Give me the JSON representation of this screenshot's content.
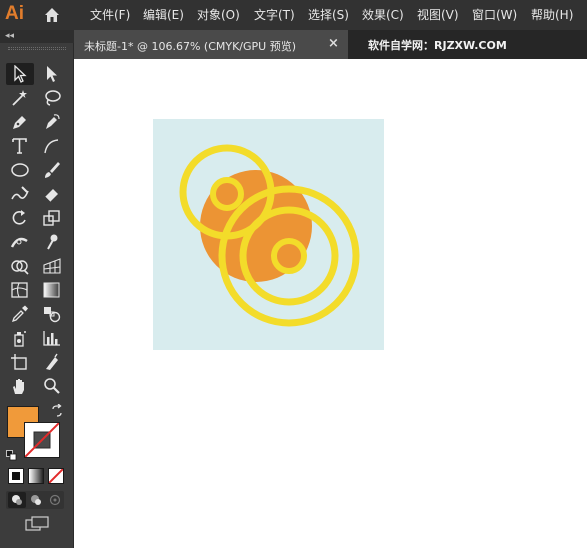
{
  "app": {
    "logo": "Ai",
    "menus": [
      "文件(F)",
      "编辑(E)",
      "对象(O)",
      "文字(T)",
      "选择(S)",
      "效果(C)",
      "视图(V)",
      "窗口(W)",
      "帮助(H)"
    ]
  },
  "tab": {
    "title": "未标题-1* @ 106.67% (CMYK/GPU 预览)",
    "close_glyph": "×"
  },
  "watermark": "软件自学网：RJZXW.COM",
  "toolbar": {
    "collapse_glyph": "◂◂",
    "tools": [
      "selection-tool",
      "direct-selection-tool",
      "magic-wand-tool",
      "lasso-tool",
      "pen-tool",
      "curvature-tool",
      "type-tool",
      "line-segment-tool",
      "ellipse-tool",
      "paintbrush-tool",
      "shaper-tool",
      "eraser-tool",
      "rotate-tool",
      "scale-tool",
      "width-tool",
      "puppet-warp-tool",
      "shape-builder-tool",
      "perspective-grid-tool",
      "mesh-tool",
      "gradient-tool",
      "eyedropper-tool",
      "blend-tool",
      "symbol-sprayer-tool",
      "column-graph-tool",
      "artboard-tool",
      "slice-tool",
      "hand-tool",
      "zoom-tool"
    ],
    "fill_color": "#f09a3a",
    "stroke": "none"
  },
  "artwork": {
    "background": "#d8ecee",
    "orange": "#ec9434",
    "yellow": "#f3dc2a"
  }
}
